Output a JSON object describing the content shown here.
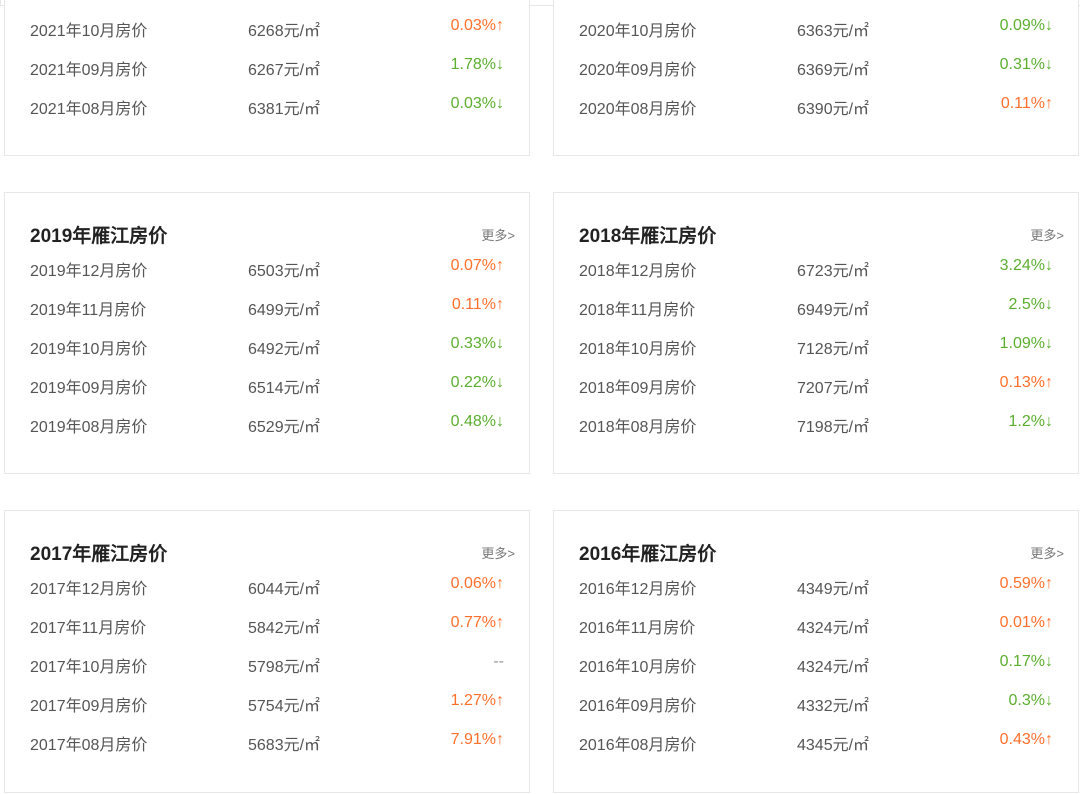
{
  "cards": {
    "c2021": {
      "title": "",
      "rows": [
        {
          "month": "2021年10月房价",
          "price": "6268元/㎡",
          "change": "0.03%↑",
          "dir": "up"
        },
        {
          "month": "2021年09月房价",
          "price": "6267元/㎡",
          "change": "1.78%↓",
          "dir": "down"
        },
        {
          "month": "2021年08月房价",
          "price": "6381元/㎡",
          "change": "0.03%↓",
          "dir": "down"
        }
      ]
    },
    "c2020": {
      "title": "",
      "rows": [
        {
          "month": "2020年10月房价",
          "price": "6363元/㎡",
          "change": "0.09%↓",
          "dir": "down"
        },
        {
          "month": "2020年09月房价",
          "price": "6369元/㎡",
          "change": "0.31%↓",
          "dir": "down"
        },
        {
          "month": "2020年08月房价",
          "price": "6390元/㎡",
          "change": "0.11%↑",
          "dir": "up"
        }
      ]
    },
    "c2019": {
      "title": "2019年雁江房价",
      "more": "更多>",
      "rows": [
        {
          "month": "2019年12月房价",
          "price": "6503元/㎡",
          "change": "0.07%↑",
          "dir": "up"
        },
        {
          "month": "2019年11月房价",
          "price": "6499元/㎡",
          "change": "0.11%↑",
          "dir": "up"
        },
        {
          "month": "2019年10月房价",
          "price": "6492元/㎡",
          "change": "0.33%↓",
          "dir": "down"
        },
        {
          "month": "2019年09月房价",
          "price": "6514元/㎡",
          "change": "0.22%↓",
          "dir": "down"
        },
        {
          "month": "2019年08月房价",
          "price": "6529元/㎡",
          "change": "0.48%↓",
          "dir": "down"
        }
      ]
    },
    "c2018": {
      "title": "2018年雁江房价",
      "more": "更多>",
      "rows": [
        {
          "month": "2018年12月房价",
          "price": "6723元/㎡",
          "change": "3.24%↓",
          "dir": "down"
        },
        {
          "month": "2018年11月房价",
          "price": "6949元/㎡",
          "change": "2.5%↓",
          "dir": "down"
        },
        {
          "month": "2018年10月房价",
          "price": "7128元/㎡",
          "change": "1.09%↓",
          "dir": "down"
        },
        {
          "month": "2018年09月房价",
          "price": "7207元/㎡",
          "change": "0.13%↑",
          "dir": "up"
        },
        {
          "month": "2018年08月房价",
          "price": "7198元/㎡",
          "change": "1.2%↓",
          "dir": "down"
        }
      ]
    },
    "c2017": {
      "title": "2017年雁江房价",
      "more": "更多>",
      "rows": [
        {
          "month": "2017年12月房价",
          "price": "6044元/㎡",
          "change": "0.06%↑",
          "dir": "up"
        },
        {
          "month": "2017年11月房价",
          "price": "5842元/㎡",
          "change": "0.77%↑",
          "dir": "up"
        },
        {
          "month": "2017年10月房价",
          "price": "5798元/㎡",
          "change": "--",
          "dir": "none"
        },
        {
          "month": "2017年09月房价",
          "price": "5754元/㎡",
          "change": "1.27%↑",
          "dir": "up"
        },
        {
          "month": "2017年08月房价",
          "price": "5683元/㎡",
          "change": "7.91%↑",
          "dir": "up"
        }
      ]
    },
    "c2016": {
      "title": "2016年雁江房价",
      "more": "更多>",
      "rows": [
        {
          "month": "2016年12月房价",
          "price": "4349元/㎡",
          "change": "0.59%↑",
          "dir": "up"
        },
        {
          "month": "2016年11月房价",
          "price": "4324元/㎡",
          "change": "0.01%↑",
          "dir": "up"
        },
        {
          "month": "2016年10月房价",
          "price": "4324元/㎡",
          "change": "0.17%↓",
          "dir": "down"
        },
        {
          "month": "2016年09月房价",
          "price": "4332元/㎡",
          "change": "0.3%↓",
          "dir": "down"
        },
        {
          "month": "2016年08月房价",
          "price": "4345元/㎡",
          "change": "0.43%↑",
          "dir": "up"
        }
      ]
    }
  },
  "colors": {
    "up": "#ff6f2c",
    "down": "#5cae2f",
    "none": "#999999"
  }
}
